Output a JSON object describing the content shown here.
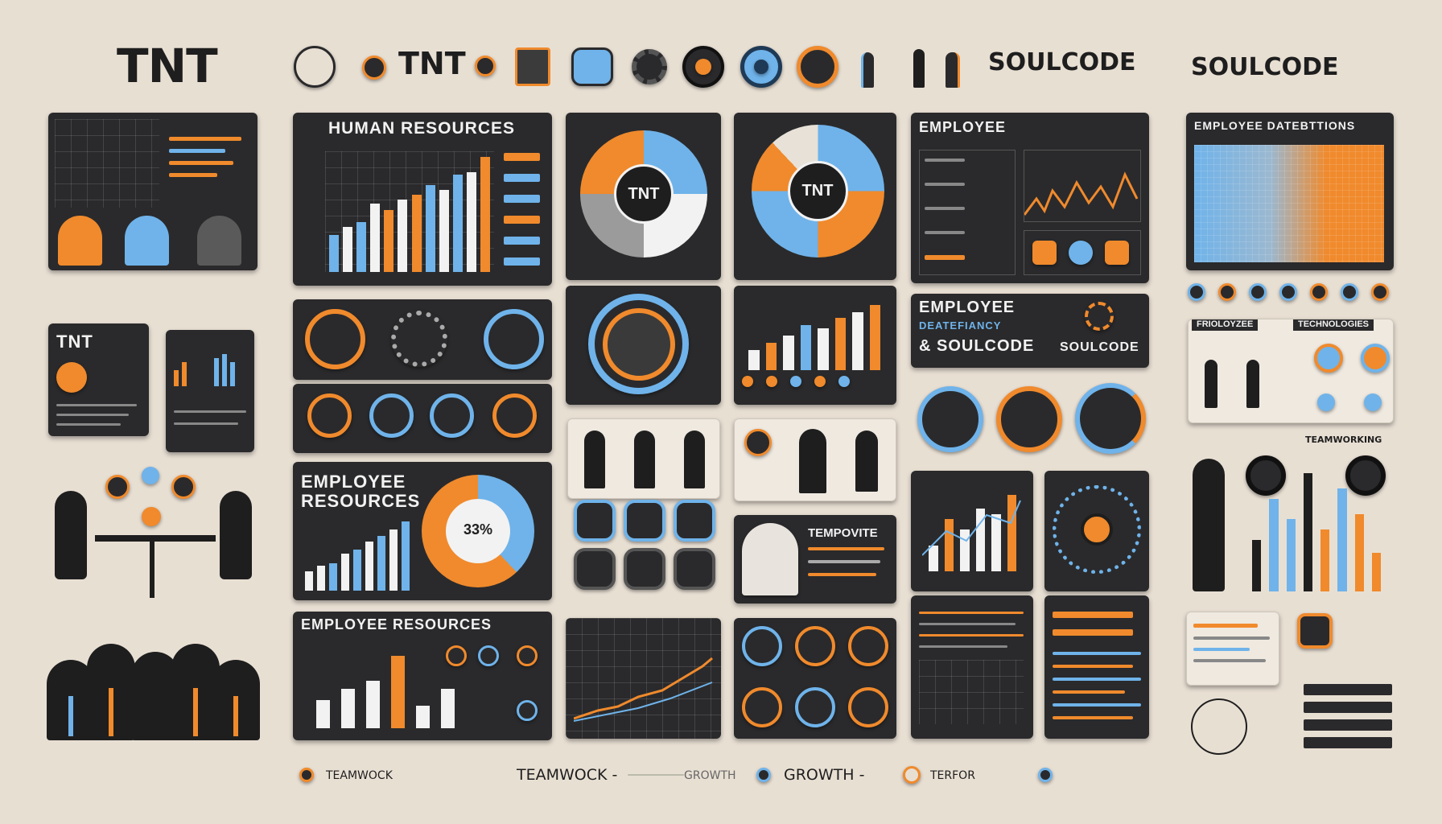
{
  "header": {
    "logo_tnt": "TNT",
    "logo_tnt_small": "TNT",
    "soulcode_1": "SOULCODE",
    "soulcode_2": "SOULCODE"
  },
  "panels": {
    "human_resources": {
      "title": "HUMAN RESOURCES"
    },
    "employee_top": {
      "title": "EMPLOYEE"
    },
    "employee_datentions": {
      "title": "EMPLOYEE DATEBTTIONS"
    },
    "tnt_card": {
      "title": "TNT"
    },
    "circle_1": {
      "label": "TNT"
    },
    "circle_2": {
      "label": "TNT"
    },
    "employee_soulcode": {
      "line1": "EMPLOYEE",
      "line2": "DEATEFIANCY",
      "line3": "& SOULCODE",
      "tag": "SOULCODE"
    },
    "employee_resources_1": {
      "line1": "EMPLOYEE",
      "line2": "RESOURCES",
      "donut_value": "33%"
    },
    "employee_resources_2": {
      "title": "EMPLOYEE RESOURCES"
    },
    "tempovite": {
      "title": "TEMPOVITE"
    },
    "technologies": {
      "label1": "FRIOLOYZEE",
      "label2": "TECHNOLOGIES"
    },
    "teamworking": {
      "label": "TEAMWORKING"
    }
  },
  "footer": {
    "items": [
      "TEAMWOCK",
      "TEAMWOCK -",
      "GROWTH -",
      "TERFOR"
    ],
    "growth_small": "GROWTH"
  },
  "colors": {
    "background": "#e8dfd3",
    "panel": "#2a2a2c",
    "orange": "#f08a2c",
    "blue": "#6fb3ea",
    "white": "#f2f2f2"
  },
  "charts": {
    "hr_bars": [
      30,
      36,
      40,
      55,
      50,
      58,
      62,
      70,
      66,
      78,
      80,
      92
    ],
    "resources_bars": [
      20,
      25,
      28,
      38,
      42,
      50,
      56,
      62,
      70
    ],
    "er2_bars": [
      20,
      28,
      34,
      52,
      16,
      28
    ],
    "mid_bars": [
      22,
      30,
      38,
      50,
      46,
      58,
      64,
      72
    ],
    "sm_bars": [
      30,
      60,
      48,
      72,
      66,
      88
    ],
    "right_bars": [
      40,
      72,
      56,
      92,
      48,
      80,
      60,
      30
    ]
  }
}
